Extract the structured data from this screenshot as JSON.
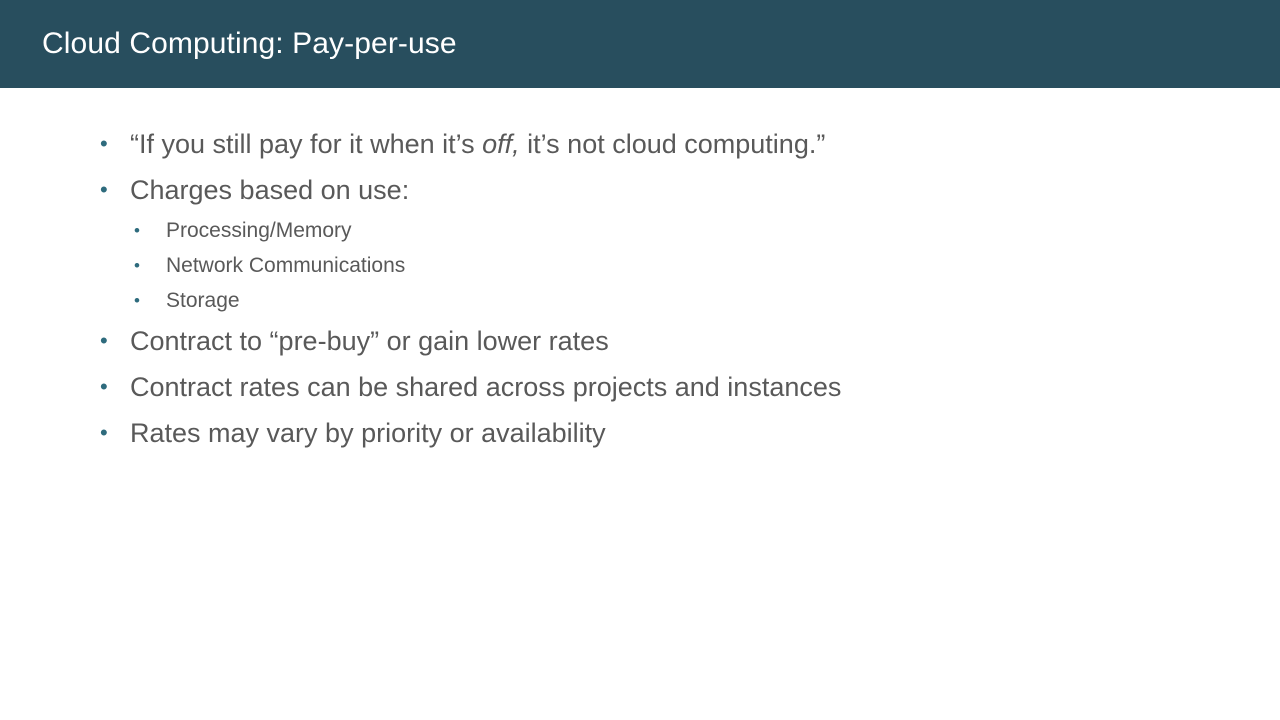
{
  "slide": {
    "title": "Cloud Computing: Pay-per-use",
    "theme": {
      "header_background": "#284e5e",
      "header_text_color": "#ffffff",
      "body_background": "#ffffff",
      "body_text_color": "#595959",
      "bullet_marker_color": "#2e6b7d"
    },
    "bullet_glyph": "•",
    "content": [
      {
        "level": 1,
        "text_before_italic": "“If you still pay for it when it’s ",
        "italic": "off,",
        "text_after_italic": " it’s not cloud computing.”"
      },
      {
        "level": 1,
        "text": "Charges based on use:",
        "children": [
          {
            "level": 2,
            "text": "Processing/Memory"
          },
          {
            "level": 2,
            "text": "Network Communications"
          },
          {
            "level": 2,
            "text": "Storage"
          }
        ]
      },
      {
        "level": 1,
        "text": "Contract to “pre-buy” or gain lower rates"
      },
      {
        "level": 1,
        "text": "Contract rates can be shared across projects and instances"
      },
      {
        "level": 1,
        "text": "Rates may vary by priority or availability"
      }
    ]
  }
}
